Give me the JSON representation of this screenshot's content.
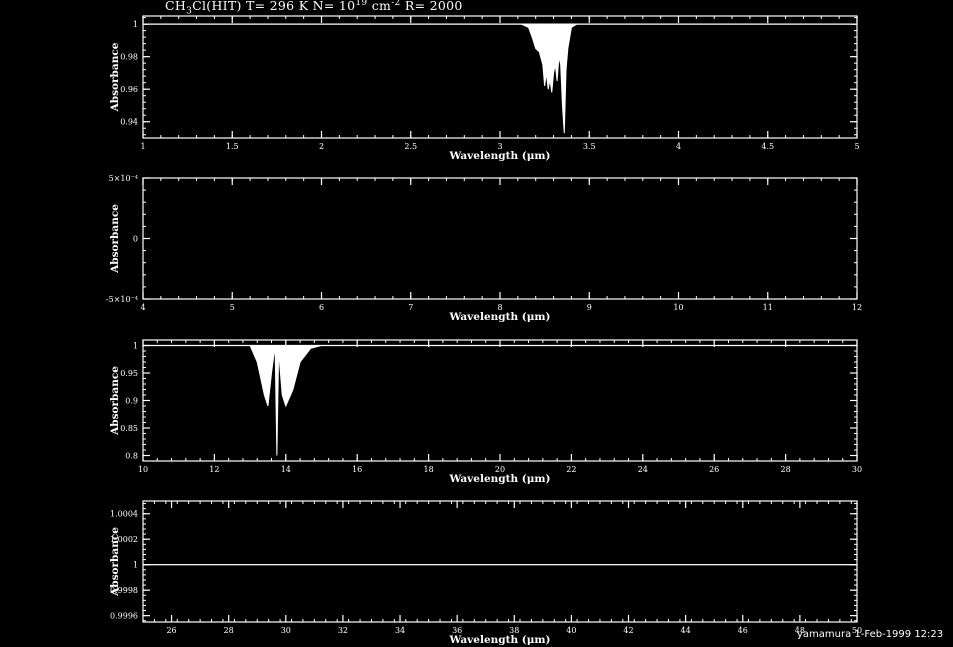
{
  "title": {
    "main": "CH",
    "sub": "3",
    "rest": "Cl(HIT) T= 296 K N= 10",
    "exp": "19",
    "unit": " cm",
    "exp2": "-2",
    "tail": " R= 2000"
  },
  "footer": "yamamura  1-Feb-1999 12:23",
  "colors": {
    "background": "#000000",
    "foreground": "#ffffff"
  },
  "chart_data": [
    {
      "type": "line",
      "xlabel": "Wavelength (μm)",
      "ylabel": "Absorbance",
      "xlim": [
        1,
        5
      ],
      "ylim": [
        0.93,
        1.005
      ],
      "xticks": [
        1,
        1.5,
        2,
        2.5,
        3,
        3.5,
        4,
        4.5,
        5
      ],
      "xtick_labels": [
        "1",
        "1.5",
        "2",
        "2.5",
        "3",
        "3.5",
        "4",
        "4.5",
        "5"
      ],
      "yticks": [
        0.94,
        0.96,
        0.98,
        1
      ],
      "ytick_labels": [
        "0.94",
        "0.96",
        "0.98",
        "1"
      ],
      "x": [
        3.12,
        3.16,
        3.18,
        3.2,
        3.22,
        3.24,
        3.25,
        3.26,
        3.27,
        3.28,
        3.29,
        3.3,
        3.31,
        3.32,
        3.33,
        3.34,
        3.35,
        3.36,
        3.37,
        3.38,
        3.4,
        3.43
      ],
      "y": [
        1.0,
        0.998,
        0.992,
        0.985,
        0.983,
        0.975,
        0.962,
        0.97,
        0.96,
        0.966,
        0.958,
        0.97,
        0.975,
        0.965,
        0.98,
        0.975,
        0.95,
        0.933,
        0.972,
        0.985,
        0.998,
        1.0
      ]
    },
    {
      "type": "line",
      "xlabel": "Wavelength (μm)",
      "ylabel": "Absorbance",
      "xlim": [
        4,
        12
      ],
      "ylim": [
        -0.0005,
        0.0005
      ],
      "xticks": [
        4,
        5,
        6,
        7,
        8,
        9,
        10,
        11,
        12
      ],
      "xtick_labels": [
        "4",
        "5",
        "6",
        "7",
        "8",
        "9",
        "10",
        "11",
        "12"
      ],
      "yticks": [
        -0.0005,
        0,
        0.0005
      ],
      "ytick_labels": [
        "-5×10⁻⁴",
        "0",
        "5×10⁻⁴"
      ],
      "x": [],
      "y": []
    },
    {
      "type": "line",
      "xlabel": "Wavelength (μm)",
      "ylabel": "Absorbance",
      "xlim": [
        10,
        30
      ],
      "ylim": [
        0.79,
        1.01
      ],
      "xticks": [
        10,
        12,
        14,
        16,
        18,
        20,
        22,
        24,
        26,
        28,
        30
      ],
      "xtick_labels": [
        "10",
        "12",
        "14",
        "16",
        "18",
        "20",
        "22",
        "24",
        "26",
        "28",
        "30"
      ],
      "yticks": [
        0.8,
        0.85,
        0.9,
        0.95,
        1
      ],
      "ytick_labels": [
        "0.8",
        "0.85",
        "0.9",
        "0.95",
        "1"
      ],
      "x": [
        13.0,
        13.2,
        13.4,
        13.5,
        13.6,
        13.7,
        13.75,
        13.8,
        13.9,
        14.0,
        14.2,
        14.4,
        14.7,
        15.0
      ],
      "y": [
        1.0,
        0.97,
        0.91,
        0.89,
        0.95,
        1.0,
        0.8,
        0.99,
        0.91,
        0.89,
        0.92,
        0.97,
        0.995,
        1.0
      ]
    },
    {
      "type": "line",
      "xlabel": "Wavelength (μm)",
      "ylabel": "Absorbance",
      "xlim": [
        25,
        50
      ],
      "ylim": [
        0.99955,
        1.0005
      ],
      "xticks": [
        26,
        28,
        30,
        32,
        34,
        36,
        38,
        40,
        42,
        44,
        46,
        48,
        50
      ],
      "xtick_labels": [
        "26",
        "28",
        "30",
        "32",
        "34",
        "36",
        "38",
        "40",
        "42",
        "44",
        "46",
        "48",
        "50"
      ],
      "yticks": [
        0.9996,
        0.9998,
        1,
        1.0002,
        1.0004
      ],
      "ytick_labels": [
        "0.9996",
        "0.9998",
        "1",
        "1.0002",
        "1.0004"
      ],
      "x": [
        25,
        50
      ],
      "y": [
        1,
        1
      ]
    }
  ]
}
